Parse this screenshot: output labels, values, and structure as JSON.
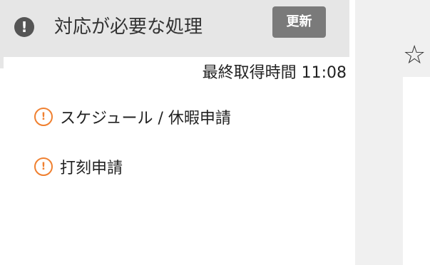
{
  "header": {
    "title": "対応が必要な処理",
    "refresh_label": "更新",
    "alert_icon": "exclamation-circle-icon"
  },
  "status": {
    "last_fetched": "最終取得時間 11:08"
  },
  "tasks": [
    {
      "label": "スケジュール / 休暇申請",
      "icon": "warning-circle-icon"
    },
    {
      "label": "打刻申請",
      "icon": "warning-circle-icon"
    }
  ],
  "side": {
    "star_icon": "star-outline-icon"
  },
  "colors": {
    "accent_warning": "#f08030",
    "header_bg": "#e6e6e6",
    "button_bg": "#7a7a7a"
  }
}
